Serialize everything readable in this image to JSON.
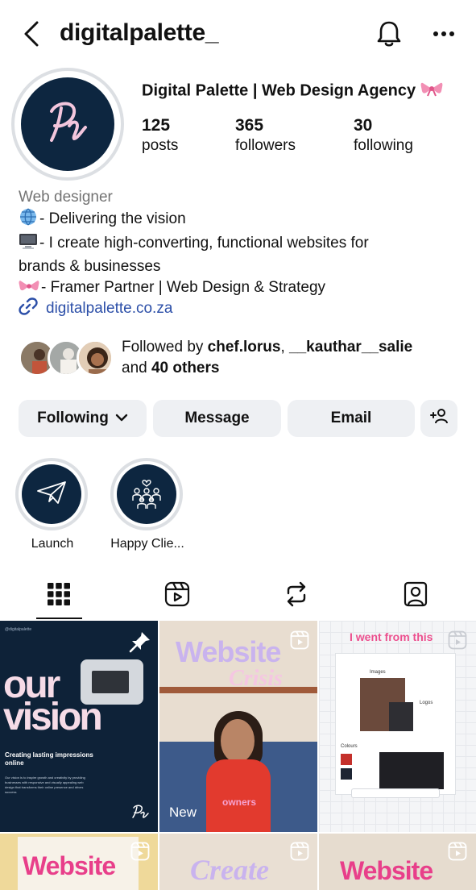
{
  "header": {
    "username": "digitalpalette_"
  },
  "profile": {
    "display_name": "Digital Palette | Web Design Agency",
    "stats": [
      {
        "value": "125",
        "label": "posts"
      },
      {
        "value": "365",
        "label": "followers"
      },
      {
        "value": "30",
        "label": "following"
      }
    ],
    "bio": {
      "category": "Web designer",
      "line1": "- Delivering the vision",
      "line2": "- I create high-converting, functional websites for",
      "line3": "brands & businesses",
      "line4": "- Framer Partner | Web Design & Strategy"
    },
    "link": "digitalpalette.co.za"
  },
  "followed_by": {
    "prefix": "Followed by ",
    "user1": "chef.lorus",
    "sep": ", ",
    "user2": "__kauthar__salie",
    "and": "and ",
    "others": "40 others"
  },
  "buttons": {
    "following": "Following",
    "message": "Message",
    "email": "Email"
  },
  "highlights": [
    {
      "label": "Launch"
    },
    {
      "label": "Happy Clie..."
    }
  ],
  "posts": {
    "p1": {
      "handle": "@digitalpalette",
      "big_line1": "our",
      "big_line2": "vision",
      "sub_title": "Creating lasting impressions online",
      "body": "Our vision is to inspire growth and creativity by providing businesses with responsive and visually appealing web design that transforms their online presence and drives success"
    },
    "p2": {
      "title": "Website",
      "subtitle": "Crisis",
      "caption": "owners",
      "badge": "New"
    },
    "p3": {
      "title": "I went from this",
      "labels": [
        "Colours",
        "Logos",
        "Images"
      ]
    },
    "p4": {
      "title": "Website"
    },
    "p5": {
      "title": "Create"
    },
    "p6": {
      "title": "Website"
    }
  },
  "colors": {
    "brand_navy": "#0d2640",
    "link_blue": "#2c4fa8",
    "button_gray": "#eef0f3"
  }
}
